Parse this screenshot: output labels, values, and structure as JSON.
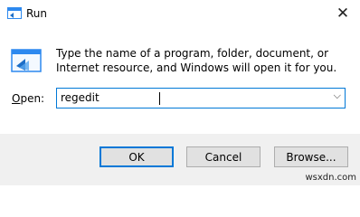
{
  "window": {
    "title": "Run",
    "close_glyph": "✕"
  },
  "message": "Type the name of a program, folder, document, or Internet resource, and Windows will open it for you.",
  "open": {
    "label_prefix": "",
    "label_underlined": "O",
    "label_rest": "pen:",
    "value": "regedit",
    "dropdown_glyph": "⌵"
  },
  "buttons": {
    "ok": "OK",
    "cancel": "Cancel",
    "browse": "Browse..."
  },
  "watermark": "wsxdn.com",
  "icons": {
    "app": "run-icon",
    "dialog": "run-icon",
    "close": "close-icon",
    "dropdown": "chevron-down-icon"
  },
  "colors": {
    "accent": "#0078d7",
    "footer": "#f0f0f0",
    "button": "#e1e1e1"
  }
}
